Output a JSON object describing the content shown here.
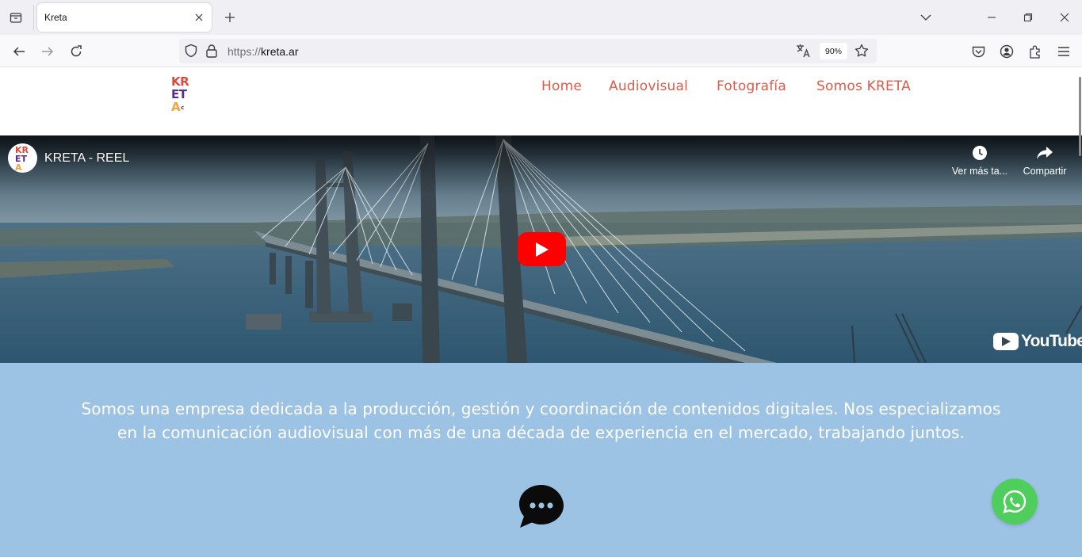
{
  "browser": {
    "tab_title": "Kreta",
    "url_protocol": "https://",
    "url_host": "kreta.ar",
    "zoom": "90%"
  },
  "site": {
    "logo": {
      "line1": [
        "K",
        "R"
      ],
      "line2": [
        "E",
        "T"
      ],
      "line3": "A",
      "mark": "c"
    },
    "nav": [
      "Home",
      "Audiovisual",
      "Fotografía",
      "Somos KRETA"
    ],
    "video": {
      "title": "KRETA - REEL",
      "watch_later": "Ver más ta...",
      "share": "Compartir",
      "brand": "YouTube"
    },
    "about_line1": "Somos una empresa dedicada a la producción, gestión y coordinación de contenidos digitales. Nos especializamos",
    "about_line2": "en la comunicación audiovisual con más de una década de experiencia en el mercado, trabajando juntos."
  },
  "colors": {
    "nav": "#e05a48",
    "logo_red": "#e0483c",
    "logo_purple": "#5b2e86",
    "logo_orange": "#f2a43a",
    "about_bg": "#9dc3e4",
    "whatsapp": "#4fce5d",
    "youtube_red": "#ff0000"
  },
  "icons": [
    "tab-list-icon",
    "close-icon",
    "plus-icon",
    "chevron-down-icon",
    "minimize-icon",
    "restore-icon",
    "back-icon",
    "forward-icon",
    "reload-icon",
    "shield-icon",
    "lock-icon",
    "translate-icon",
    "star-icon",
    "pocket-icon",
    "account-icon",
    "extensions-icon",
    "menu-icon",
    "clock-icon",
    "share-icon",
    "play-icon",
    "chat-icon",
    "whatsapp-icon"
  ]
}
